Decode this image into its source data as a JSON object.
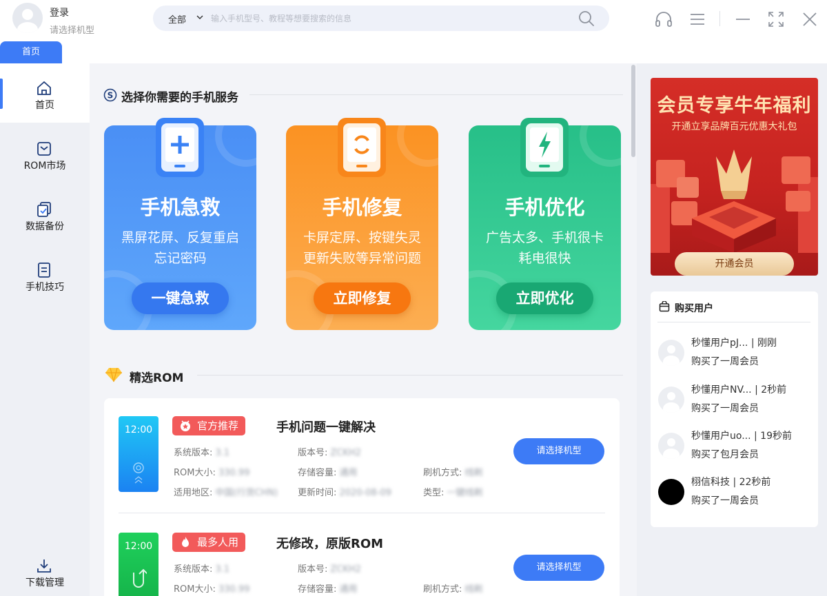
{
  "header": {
    "login_label": "登录",
    "login_sub": "请选择机型",
    "search_scope": "全部",
    "search_placeholder": "输入手机型号、教程等想要搜索的信息",
    "home_tab": "首页"
  },
  "icons": {
    "headset": "headset-icon",
    "menu": "menu-icon",
    "minimize": "minimize-icon",
    "fullscreen": "fullscreen-icon",
    "close": "close-icon"
  },
  "sidebar": {
    "items": [
      {
        "label": "首页",
        "icon": "home-icon",
        "active": true
      },
      {
        "label": "ROM市场",
        "icon": "rom-market-icon"
      },
      {
        "label": "数据备份",
        "icon": "backup-icon"
      },
      {
        "label": "手机技巧",
        "icon": "tips-icon"
      }
    ],
    "download": {
      "label": "下载管理",
      "icon": "download-icon"
    }
  },
  "services": {
    "section_title": "选择你需要的手机服务",
    "cards": [
      {
        "title": "手机急救",
        "desc1": "黑屏花屏、反复重启",
        "desc2": "忘记密码",
        "button": "一键急救",
        "color": "#4a8ff5"
      },
      {
        "title": "手机修复",
        "desc1": "卡屏定屏、按键失灵",
        "desc2": "更新失败等异常问题",
        "button": "立即修复",
        "color": "#fb9a26"
      },
      {
        "title": "手机优化",
        "desc1": "广告太多、手机很卡",
        "desc2": "耗电很快",
        "button": "立即优化",
        "color": "#2fc68e"
      }
    ]
  },
  "rom": {
    "section_title": "精选ROM",
    "items": [
      {
        "time": "12:00",
        "badge": "官方推荐",
        "name": "手机问题一键解决",
        "fields": {
          "sys_label": "系统版本:",
          "sys_val": "3.1",
          "build_label": "版本号:",
          "build_val": "ZCKH2",
          "size_label": "ROM大小:",
          "size_val": "330.99",
          "storage_label": "存储容量:",
          "storage_val": "通用",
          "flash_label": "刷机方式:",
          "flash_val": "线刷",
          "region_label": "适用地区:",
          "region_val": "中国(行货CHN)",
          "updated_label": "更新时间:",
          "updated_val": "2020-08-09",
          "type_label": "类型:",
          "type_val": "一键线刷"
        },
        "button": "请选择机型"
      },
      {
        "time": "12:00",
        "badge": "最多人用",
        "name": "无修改，原版ROM",
        "fields": {
          "sys_label": "系统版本:",
          "sys_val": "3.1",
          "build_label": "版本号:",
          "build_val": "ZCKH2",
          "size_label": "ROM大小:",
          "size_val": "330.99",
          "storage_label": "存储容量:",
          "storage_val": "通用",
          "flash_label": "刷机方式:",
          "flash_val": "线刷"
        },
        "button": "请选择机型"
      }
    ]
  },
  "banner": {
    "title": "会员专享牛年福利",
    "subtitle": "开通立享品牌百元优惠大礼包",
    "button": "开通会员"
  },
  "buyers": {
    "title": "购买用户",
    "list": [
      {
        "name": "秒懂用户pJ...",
        "time": "| 刚刚",
        "action": "购买了一周会员"
      },
      {
        "name": "秒懂用户NV...",
        "time": "| 2秒前",
        "action": "购买了一周会员"
      },
      {
        "name": "秒懂用户uo...",
        "time": "| 19秒前",
        "action": "购买了包月会员"
      },
      {
        "name": "栩信科技",
        "time": "| 22秒前",
        "action": "购买了一周会员"
      }
    ]
  }
}
